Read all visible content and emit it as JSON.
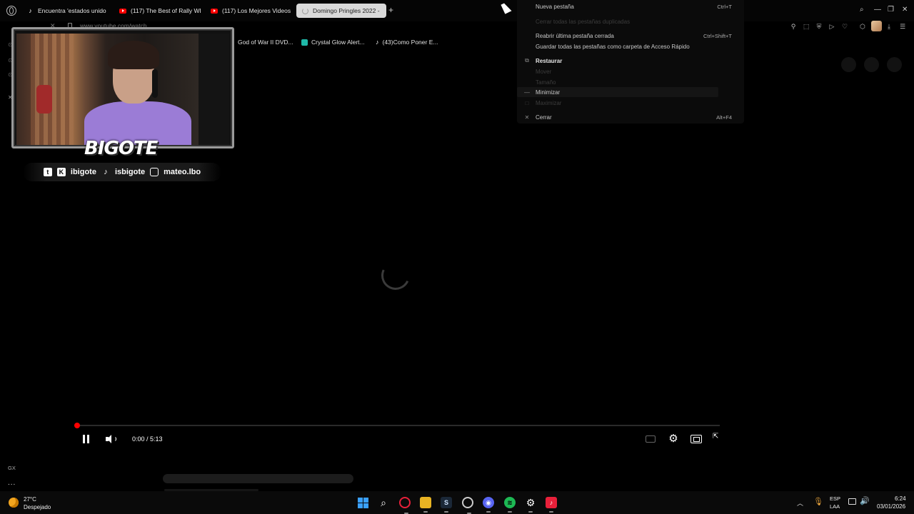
{
  "tabs": [
    {
      "label": "Encuentra 'estados unido",
      "icon": "tiktok-icon",
      "active": false
    },
    {
      "label": "(117) The Best of Rally WR",
      "icon": "youtube-icon",
      "active": false
    },
    {
      "label": "(117) Los Mejores Videos d",
      "icon": "youtube-icon",
      "active": false
    },
    {
      "label": "Domingo Pringles 2022 -",
      "icon": "loading-icon",
      "active": true
    }
  ],
  "new_tab_symbol": "+",
  "address_bar": {
    "url": "www.youtube.com/watch"
  },
  "bookmarks": [
    {
      "label": "God of War II DVD...",
      "icon": "bookmark-icon"
    },
    {
      "label": "Crystal Glow Alert...",
      "icon": "crystal-glow-icon"
    },
    {
      "label": "(43)Como Poner E...",
      "icon": "tiktok-icon"
    }
  ],
  "overlay": {
    "brand": "BIGOTE",
    "socials": [
      {
        "icon": "twitch-icon",
        "glyph": "t"
      },
      {
        "icon": "kick-icon",
        "glyph": "K",
        "handle": "ibigote"
      },
      {
        "icon": "tiktok-icon",
        "glyph": "♪",
        "handle": "isbigote"
      },
      {
        "icon": "instagram-icon",
        "glyph": "◎",
        "handle": "mateo.lbo"
      }
    ]
  },
  "player": {
    "time": "0:00 / 5:13",
    "progress": 0.0
  },
  "context_menu": {
    "items": [
      {
        "icon": "",
        "label": "Nueva pestaña",
        "shortcut": "Ctrl+T",
        "disabled": false,
        "bold": false
      },
      {
        "icon": "",
        "label": "Cerrar todas las pestañas duplicadas",
        "shortcut": "",
        "disabled": true,
        "bold": false
      },
      {
        "icon": "",
        "label": "Reabrir última pestaña cerrada",
        "shortcut": "Ctrl+Shift+T",
        "disabled": false,
        "bold": false
      },
      {
        "icon": "",
        "label": "Guardar todas las pestañas como carpeta de Acceso Rápido",
        "shortcut": "",
        "disabled": false,
        "bold": false
      },
      {
        "icon": "⧉",
        "label": "Restaurar",
        "shortcut": "",
        "disabled": false,
        "bold": true
      },
      {
        "icon": "",
        "label": "Mover",
        "shortcut": "",
        "disabled": true,
        "bold": false
      },
      {
        "icon": "",
        "label": "Tamaño",
        "shortcut": "",
        "disabled": true,
        "bold": false
      },
      {
        "icon": "—",
        "label": "Minimizar",
        "shortcut": "",
        "disabled": false,
        "bold": false
      },
      {
        "icon": "□",
        "label": "Maximizar",
        "shortcut": "",
        "disabled": true,
        "bold": false
      },
      {
        "icon": "✕",
        "label": "Cerrar",
        "shortcut": "Alt+F4",
        "disabled": false,
        "bold": false
      }
    ]
  },
  "sidebar": {
    "gx_label": "GX",
    "more_label": "..."
  },
  "taskbar": {
    "weather_temp": "27°C",
    "weather_desc": "Despejado",
    "lang_top": "ESP",
    "lang_bottom": "LAA",
    "time": "6:24",
    "date": "03/01/2026",
    "apps": [
      {
        "name": "start-button"
      },
      {
        "name": "search-icon"
      },
      {
        "name": "opera-gx-icon"
      },
      {
        "name": "file-explorer-icon"
      },
      {
        "name": "steam-icon"
      },
      {
        "name": "obs-icon"
      },
      {
        "name": "discord-icon"
      },
      {
        "name": "spotify-icon"
      },
      {
        "name": "settings-icon"
      },
      {
        "name": "tiktok-icon"
      }
    ]
  },
  "colors": {
    "accent_red": "#ff0000",
    "opera_red": "#e8203a",
    "spotify_green": "#1db954",
    "discord": "#5865f2"
  }
}
